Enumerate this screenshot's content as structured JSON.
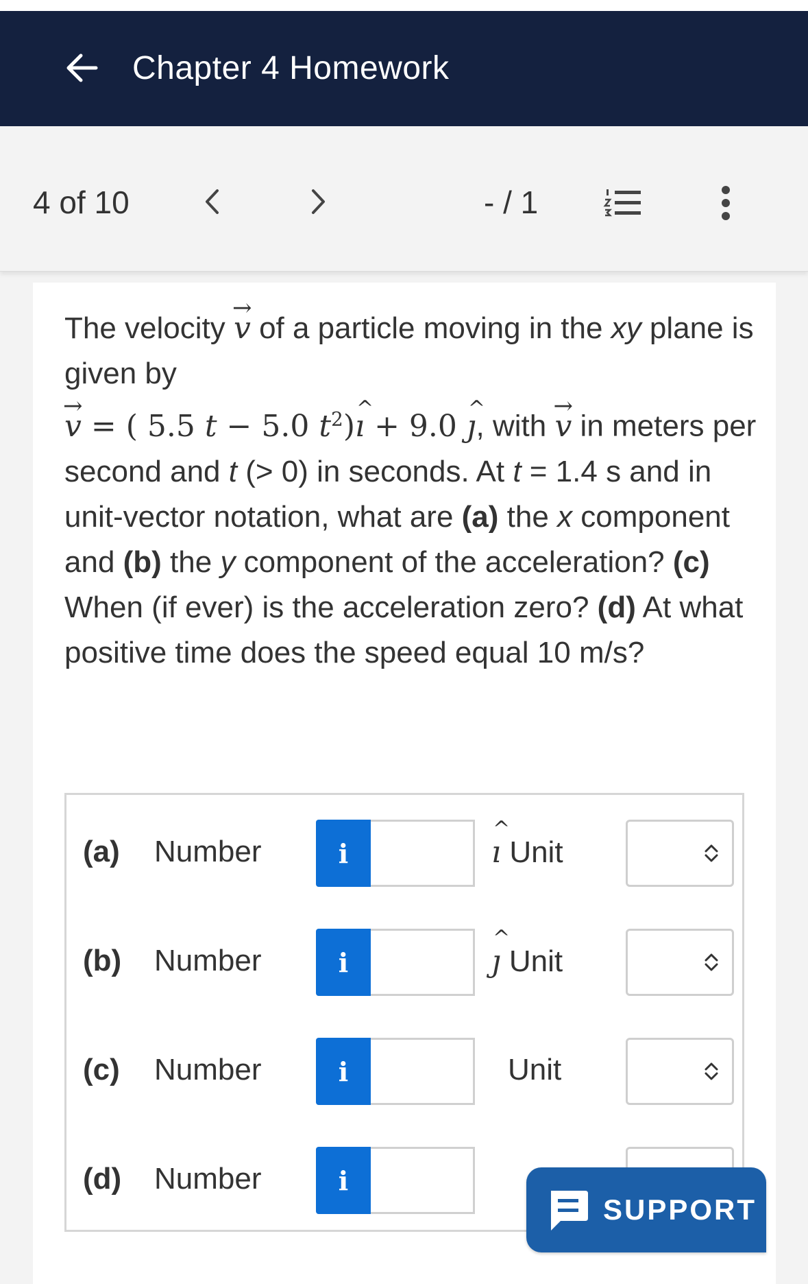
{
  "header": {
    "title": "Chapter 4 Homework",
    "back_icon": "arrow-left-icon"
  },
  "toolbar": {
    "position": "4 of 10",
    "score": "- / 1",
    "prev_icon": "chevron-left-icon",
    "next_icon": "chevron-right-icon",
    "list_icon": "numbered-list-icon",
    "more_icon": "more-vertical-icon"
  },
  "question": {
    "p1": "The velocity ",
    "v": "v",
    "p2": " of a particle moving in the ",
    "xy": "xy",
    "p3": " plane is given by",
    "eq_a": " = ( 5.5 ",
    "t1": "t",
    "eq_b": " − 5.0 ",
    "t2": "t",
    "eq_c": ")",
    "i": "ı",
    "eq_d": " + 9.0 ",
    "j": "ȷ",
    "p4": ", with ",
    "p5": " in meters per second and ",
    "t3": "t",
    "p6": " (> 0) in seconds. At ",
    "t4": "t",
    "p7": " = 1.4 s and in unit-vector notation, what are ",
    "a": "(a)",
    "p8": " the ",
    "x": "x",
    "p9": " component and ",
    "b": "(b)",
    "p10": " the ",
    "y": "y",
    "p11": " component of the acceleration? ",
    "c": "(c)",
    "p12": " When (if ever) is the acceleration zero? ",
    "d": "(d)",
    "p13": " At what positive time does the speed equal 10 m/s?"
  },
  "answers": [
    {
      "part": "(a)",
      "number_label": "Number",
      "info": "i",
      "unit_label": "Unit",
      "unit_prefix": "ı",
      "value": ""
    },
    {
      "part": "(b)",
      "number_label": "Number",
      "info": "i",
      "unit_label": "Unit",
      "unit_prefix": "ȷ",
      "value": ""
    },
    {
      "part": "(c)",
      "number_label": "Number",
      "info": "i",
      "unit_label": "Unit",
      "unit_prefix": "",
      "value": ""
    },
    {
      "part": "(d)",
      "number_label": "Number",
      "info": "i",
      "unit_label": "",
      "unit_prefix": "",
      "value": ""
    }
  ],
  "support": {
    "label": "SUPPORT",
    "icon": "chat-icon"
  },
  "colors": {
    "header_bg": "#14213f",
    "info_button": "#0d6fd6",
    "support_bg": "#1c5fa8"
  }
}
